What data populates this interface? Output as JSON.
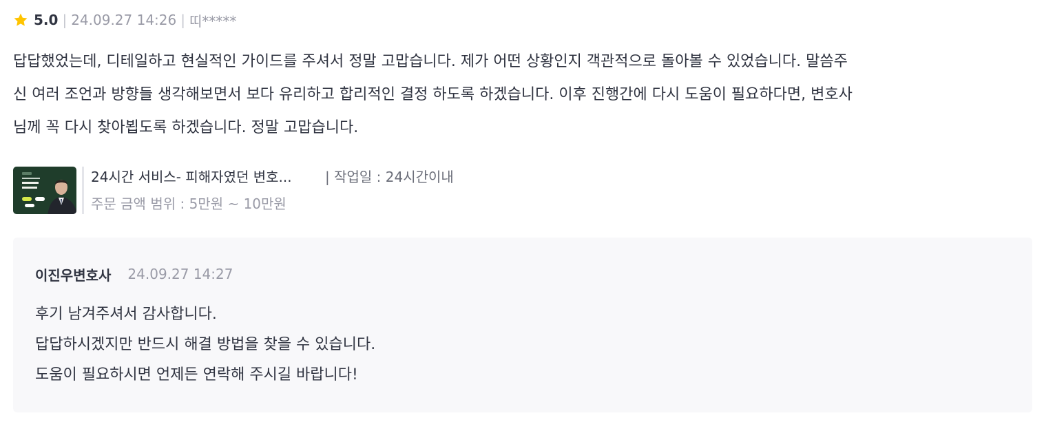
{
  "review": {
    "star_icon": "star-icon",
    "star_color": "#ffc400",
    "rating": "5.0",
    "date": "24.09.27 14:26",
    "author": "띠*****",
    "body_lines": [
      "답답했었는데, 디테일하고 현실적인 가이드를 주셔서 정말 고맙습니다. 제가 어떤 상황인지 객관적으로 돌아볼 수 있었습니다. 말씀주",
      "신 여러 조언과 방향들 생각해보면서 보다 유리하고 합리적인 결정 하도록 하겠습니다. 이후 진행간에 다시 도움이 필요하다면, 변호사",
      "님께 꼭 다시 찾아뵙도록 하겠습니다. 정말 고맙습니다."
    ]
  },
  "service": {
    "thumbnail_icon": "lawyer-thumbnail-image",
    "title": "24시간 서비스- 피해자였던 변호...",
    "work_period": "| 작업일 : 24시간이내",
    "price_range": "주문 금액 범위 : 5만원 ~ 10만원"
  },
  "reply": {
    "author": "이진우변호사",
    "date": "24.09.27 14:27",
    "lines": [
      "후기 남겨주셔서 감사합니다.",
      "답답하시겠지만 반드시 해결 방법을 찾을 수 있습니다.",
      "도움이 필요하시면 언제든 연락해 주시길 바랍니다!"
    ]
  }
}
